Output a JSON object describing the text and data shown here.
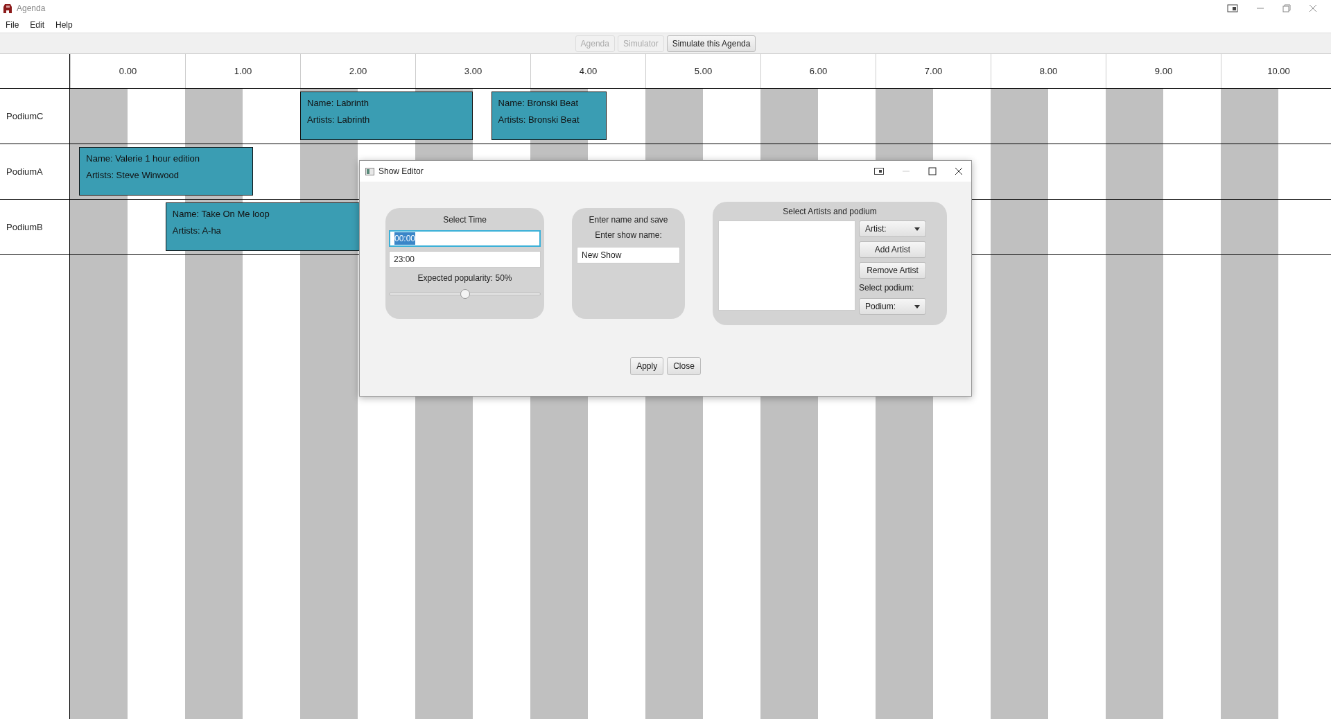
{
  "window": {
    "title": "Agenda"
  },
  "menu": [
    "File",
    "Edit",
    "Help"
  ],
  "toolbar": [
    {
      "label": "Agenda",
      "disabled": true
    },
    {
      "label": "Simulator",
      "disabled": true
    },
    {
      "label": "Simulate this Agenda",
      "disabled": false
    }
  ],
  "timeline": {
    "hours": [
      "0.00",
      "1.00",
      "2.00",
      "3.00",
      "4.00",
      "5.00",
      "6.00",
      "7.00",
      "8.00",
      "9.00",
      "10.00"
    ],
    "podiums": [
      {
        "name": "PodiumC",
        "shows": [
          {
            "name": "Name: Labrinth",
            "artists": "Artists: Labrinth"
          },
          {
            "name": "Name: Bronski Beat",
            "artists": "Artists: Bronski Beat"
          }
        ]
      },
      {
        "name": "PodiumA",
        "shows": [
          {
            "name": "Name: Valerie 1 hour edition",
            "artists": "Artists: Steve Winwood"
          }
        ]
      },
      {
        "name": "PodiumB",
        "shows": [
          {
            "name": "Name: Take On Me loop",
            "artists": "Artists: A-ha"
          }
        ]
      }
    ]
  },
  "dialog": {
    "title": "Show Editor",
    "time_panel": {
      "title": "Select Time",
      "start_time": {
        "value": "00:00",
        "focused": true
      },
      "end_time": {
        "value": "23:00",
        "focused": false
      },
      "popularity_label": "Expected popularity: 50%",
      "popularity": {
        "level": 0.5
      }
    },
    "name_panel": {
      "title": "Enter name and save",
      "label": "Enter show name:",
      "show_name": "New Show"
    },
    "artist_panel": {
      "title": "Select Artists and podium",
      "artist_select": "Artist:",
      "add_button": "Add Artist",
      "remove_button": "Remove Artist",
      "podium_label": "Select podium:",
      "podium_select": "Podium:"
    },
    "buttons": [
      "Apply",
      "Close"
    ]
  }
}
